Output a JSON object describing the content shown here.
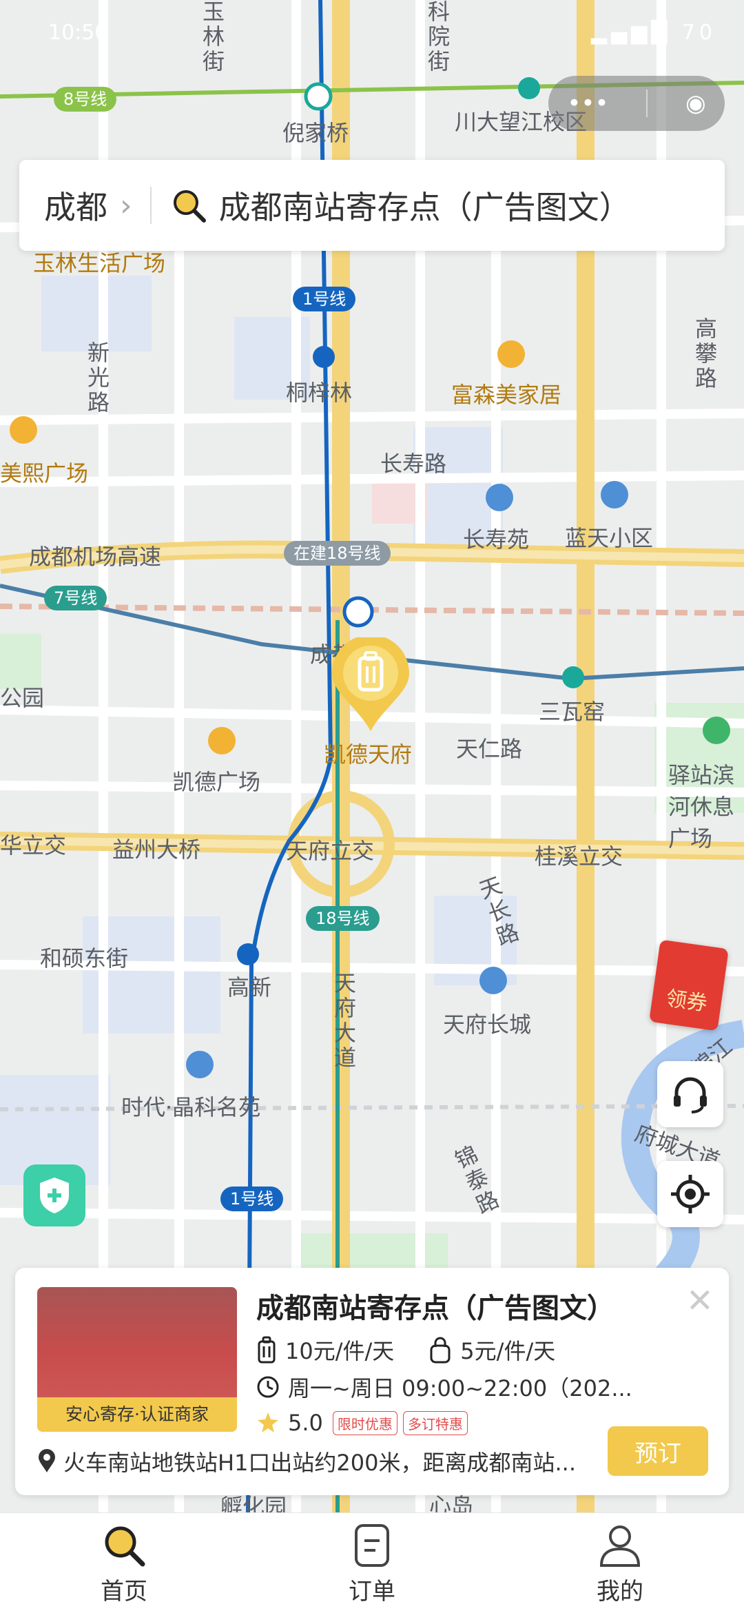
{
  "status_bar": {
    "time": "10:50",
    "battery": "70"
  },
  "search": {
    "city": "成都",
    "query": "成都南站寄存点（广告图文）"
  },
  "map": {
    "metro_badges": [
      "8号线",
      "1号线",
      "在建18号线",
      "7号线",
      "18号线",
      "1号线"
    ],
    "stations": [
      "倪家桥",
      "川大望江校区",
      "桐梓林",
      "高新",
      "三瓦窑",
      "成都南站"
    ],
    "labels": [
      "玉林生活广场",
      "新光路",
      "富森美家居",
      "美熙广场",
      "长寿路",
      "长寿苑",
      "蓝天小区",
      "成都机场高速",
      "公园",
      "凯德广场",
      "凯德天府",
      "天仁路",
      "驿站滨河休息广场",
      "华立交",
      "益州大桥",
      "天府立交",
      "桂溪立交",
      "和硕东街",
      "天长路",
      "天府大道",
      "天府长城",
      "锦江",
      "时代·晶科名苑",
      "府城大道",
      "锦泰路",
      "孵化园",
      "心岛",
      "高攀路",
      "玉林街",
      "科院街"
    ]
  },
  "coupon": {
    "label": "领券"
  },
  "card": {
    "title": "成都南站寄存点（广告图文）",
    "thumb_badge": "安心寄存·认证商家",
    "price_large": "10元/件/天",
    "price_small": "5元/件/天",
    "hours": "周一~周日 09:00~22:00（202...",
    "rating": "5.0",
    "tags": [
      "限时优惠",
      "多订特惠"
    ],
    "address": "火车南站地铁站H1口出站约200米，距离成都南站...",
    "book_label": "预订"
  },
  "tabs": [
    {
      "label": "首页",
      "icon": "search-icon"
    },
    {
      "label": "订单",
      "icon": "order-icon"
    },
    {
      "label": "我的",
      "icon": "user-icon"
    }
  ],
  "colors": {
    "accent": "#f2c94c",
    "metro_blue": "#1565c0",
    "metro_teal": "#2a9d8f",
    "metro_green": "#8bc34a"
  }
}
